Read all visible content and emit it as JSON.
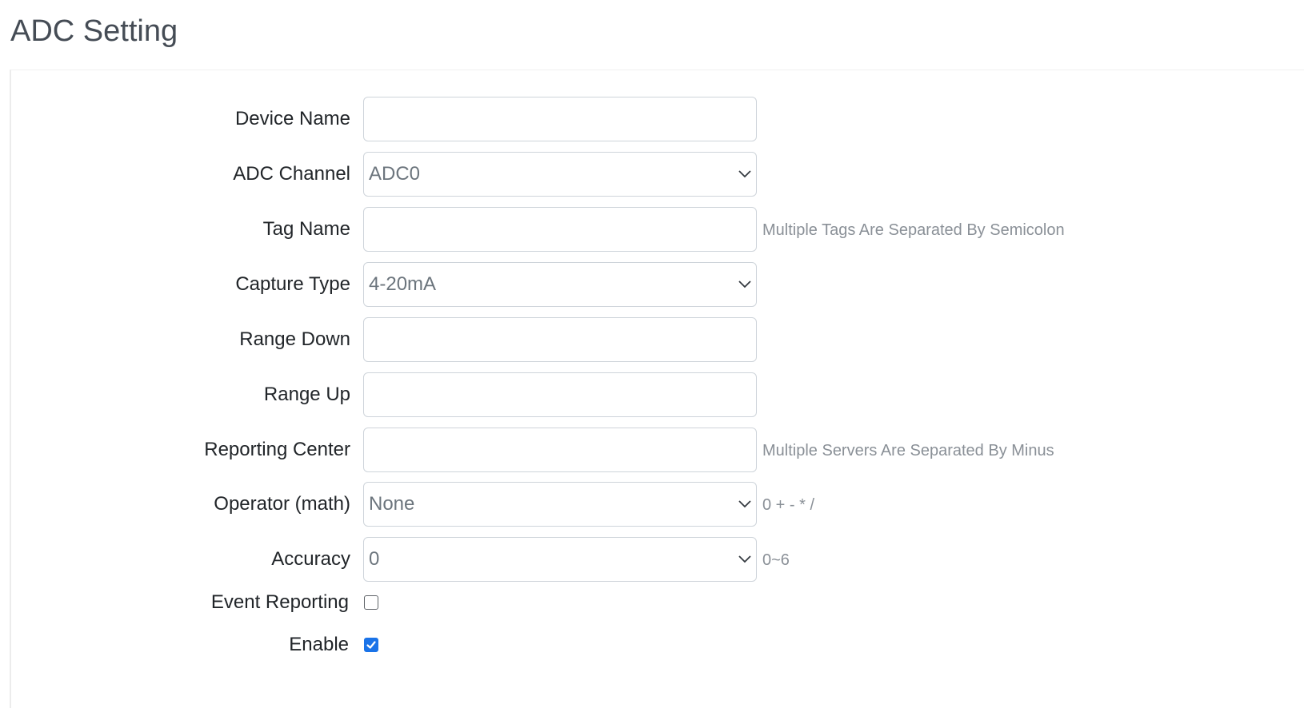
{
  "page": {
    "title": "ADC Setting"
  },
  "form": {
    "device_name": {
      "label": "Device Name",
      "value": ""
    },
    "adc_channel": {
      "label": "ADC Channel",
      "selected": "ADC0"
    },
    "tag_name": {
      "label": "Tag Name",
      "value": "",
      "help": "Multiple Tags Are Separated By Semicolon"
    },
    "capture_type": {
      "label": "Capture Type",
      "selected": "4-20mA"
    },
    "range_down": {
      "label": "Range Down",
      "value": ""
    },
    "range_up": {
      "label": "Range Up",
      "value": ""
    },
    "reporting_center": {
      "label": "Reporting Center",
      "value": "",
      "help": "Multiple Servers Are Separated By Minus"
    },
    "operator": {
      "label": "Operator (math)",
      "selected": "None",
      "help": "0 + - * /"
    },
    "accuracy": {
      "label": "Accuracy",
      "selected": "0",
      "help": "0~6"
    },
    "event_reporting": {
      "label": "Event Reporting",
      "checked": false
    },
    "enable": {
      "label": "Enable",
      "checked": true
    }
  },
  "icons": {
    "select_arrow": "chevron-down-icon",
    "checkbox_check": "check-icon"
  },
  "colors": {
    "checkbox_checked": "#1a73e8",
    "input_border": "#ced4da",
    "help_text": "#8a9097",
    "title": "#454c55"
  }
}
